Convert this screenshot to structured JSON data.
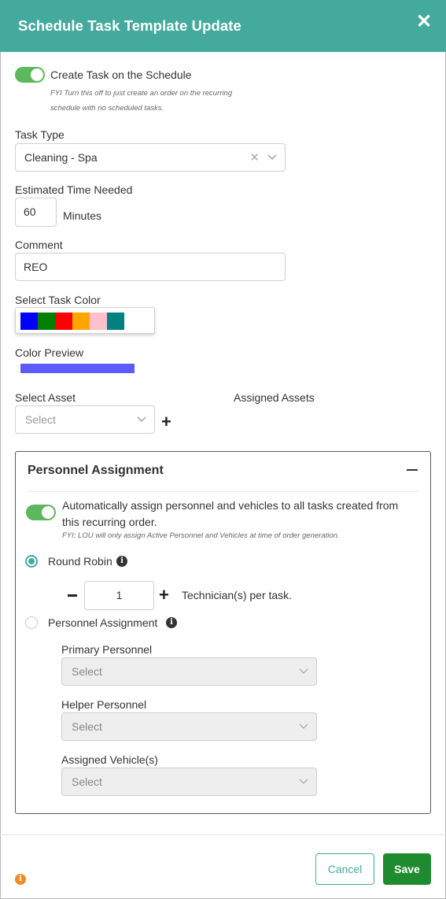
{
  "header": {
    "title": "Schedule Task Template Update",
    "close_icon": "close-icon"
  },
  "create_task": {
    "label": "Create Task on the Schedule",
    "enabled": true,
    "fyi_line1": "FYI Turn this off to just create an order on the recurring",
    "fyi_line2": "schedule with no scheduled tasks."
  },
  "task_type": {
    "label": "Task Type",
    "value": "Cleaning - Spa"
  },
  "estimated_time": {
    "label": "Estimated Time Needed",
    "value": "60",
    "unit": "Minutes"
  },
  "comment": {
    "label": "Comment",
    "value": "REO"
  },
  "task_color": {
    "label": "Select Task Color",
    "swatches": [
      "#0000ff",
      "#008000",
      "#ff0000",
      "#ffa500",
      "#ffc0cb",
      "#008080"
    ]
  },
  "color_preview": {
    "label": "Color Preview",
    "color": "#5b5bff"
  },
  "asset": {
    "label": "Select Asset",
    "placeholder": "Select",
    "assigned_label": "Assigned Assets"
  },
  "personnel": {
    "title": "Personnel Assignment",
    "auto_assign_line1": "Automatically assign personnel and vehicles to all tasks created from",
    "auto_assign_line2": "this recurring order.",
    "auto_assign_enabled": true,
    "fyi": "FYI: LOU will only assign Active Personnel and Vehicles at time of order generation.",
    "round_robin": {
      "label": "Round Robin",
      "selected": true
    },
    "technicians": {
      "value": "1",
      "suffix": "Technician(s) per task."
    },
    "personnel_assignment": {
      "label": "Personnel Assignment",
      "selected": false
    },
    "primary": {
      "label": "Primary Personnel",
      "placeholder": "Select"
    },
    "helper": {
      "label": "Helper Personnel",
      "placeholder": "Select"
    },
    "vehicles": {
      "label": "Assigned Vehicle(s)",
      "placeholder": "Select"
    }
  },
  "footer": {
    "cancel_label": "Cancel",
    "save_label": "Save"
  }
}
